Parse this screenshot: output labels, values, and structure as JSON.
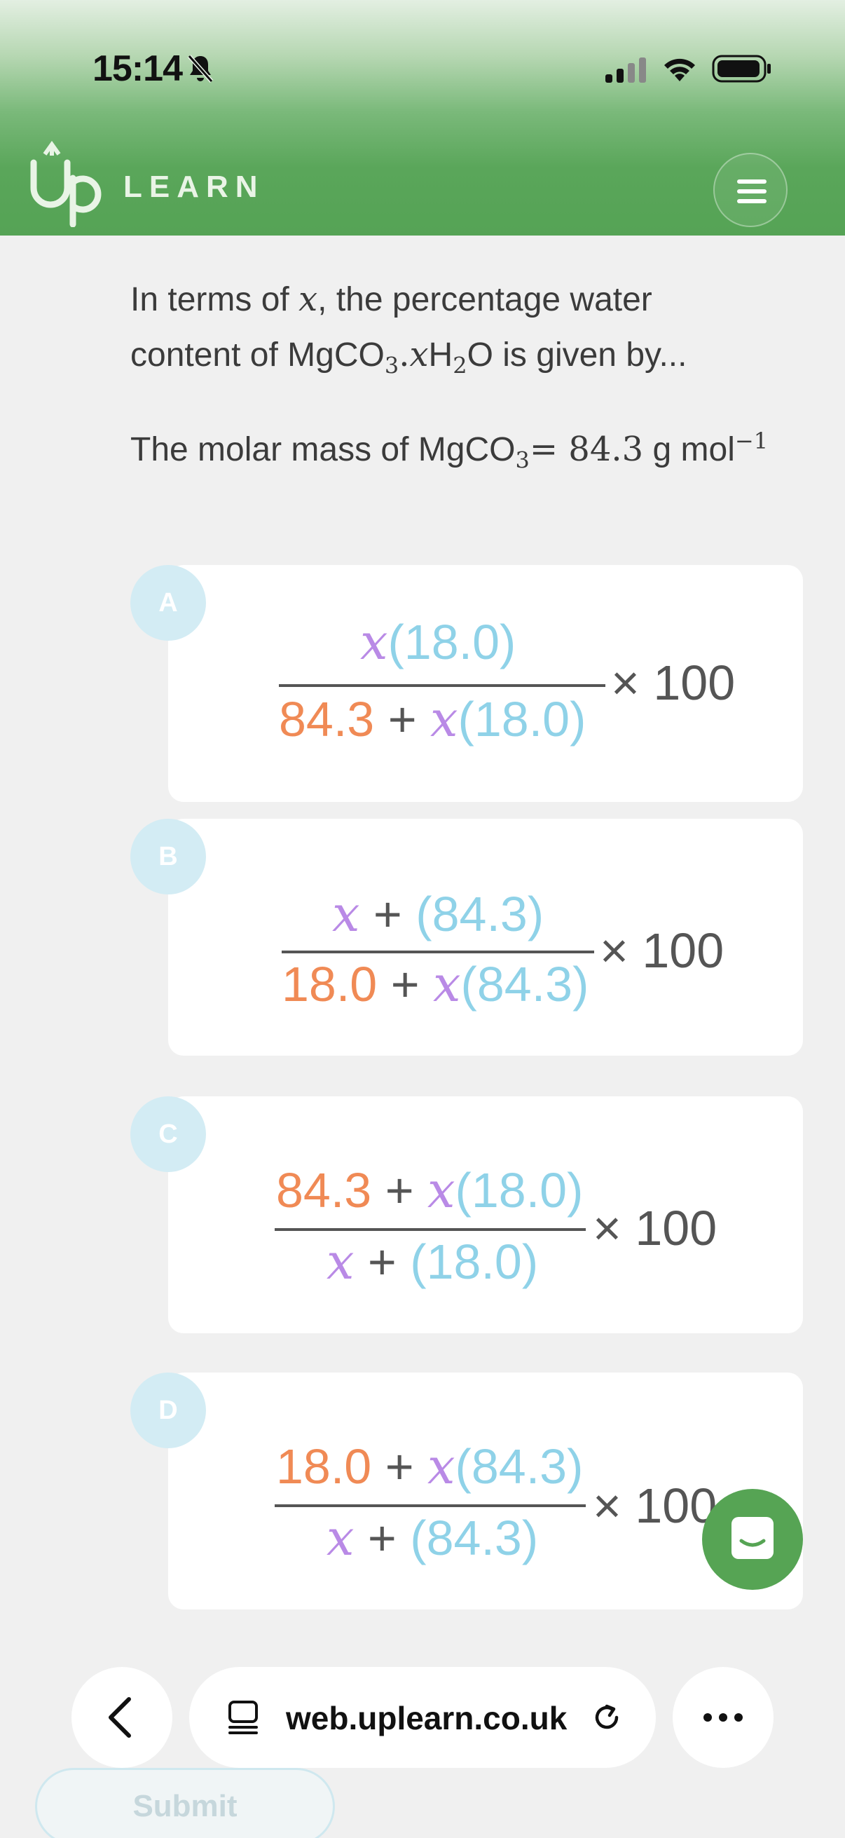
{
  "status_bar": {
    "time": "15:14"
  },
  "app": {
    "logo_text": "LEARN"
  },
  "question": {
    "line1_a": "In terms of ",
    "line1_x": "x",
    "line1_b": ", the percentage water",
    "line2_a": "content of MgCO",
    "line2_sub": "3",
    "line2_dot": ".",
    "line2_x": "x",
    "line2_h": "H",
    "line2_sub2": "2",
    "line2_b": "O is given by...",
    "molar_a": "The molar mass of MgCO",
    "molar_sub": "3",
    "molar_eq": "= 84.3",
    "molar_unit": " g mol",
    "molar_sup": "−1"
  },
  "options": [
    {
      "letter": "A",
      "num": [
        "x",
        "(18.0)"
      ],
      "den": [
        "84.3",
        " + ",
        "x",
        "(18.0)"
      ],
      "times": "× 100"
    },
    {
      "letter": "B",
      "num": [
        "x",
        " + ",
        "(84.3)"
      ],
      "den": [
        "18.0",
        " + ",
        "x",
        "(84.3)"
      ],
      "times": "× 100"
    },
    {
      "letter": "C",
      "num": [
        "84.3",
        " + ",
        "x",
        "(18.0)"
      ],
      "den": [
        "x",
        " + ",
        "(18.0)"
      ],
      "times": "× 100"
    },
    {
      "letter": "D",
      "num": [
        "18.0",
        " + ",
        "x",
        "(84.3)"
      ],
      "den": [
        "x",
        " + ",
        "(84.3)"
      ],
      "times": "× 100"
    }
  ],
  "browser": {
    "url": "web.uplearn.co.uk"
  },
  "submit_label": "Submit",
  "colors": {
    "header_green": "#55a355",
    "accent_purple": "#b98ae6",
    "accent_blue": "#8fd2e8",
    "accent_orange": "#f08a55"
  }
}
